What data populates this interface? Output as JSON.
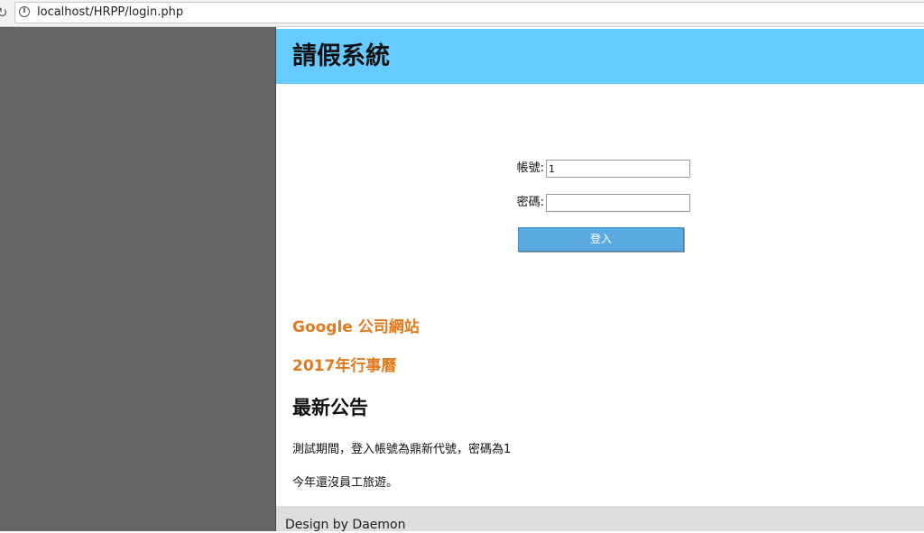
{
  "browser": {
    "url": "localhost/HRPP/login.php"
  },
  "header": {
    "title": "請假系統",
    "background_color": "#66ccff"
  },
  "login": {
    "username_label": "帳號:",
    "username_value": "1",
    "password_label": "密碼:",
    "password_value": "",
    "submit_label": "登入"
  },
  "links": [
    {
      "label": "Google 公司網站"
    },
    {
      "label": "2017年行事曆"
    }
  ],
  "news": {
    "heading": "最新公告",
    "items": [
      "測試期間，登入帳號為鼎新代號，密碼為1",
      "今年還沒員工旅遊。"
    ]
  },
  "footer": {
    "text": "Design by Daemon"
  },
  "colors": {
    "link": "#e07a1f",
    "left_panel": "#666666",
    "button": "#5aa9e0"
  }
}
